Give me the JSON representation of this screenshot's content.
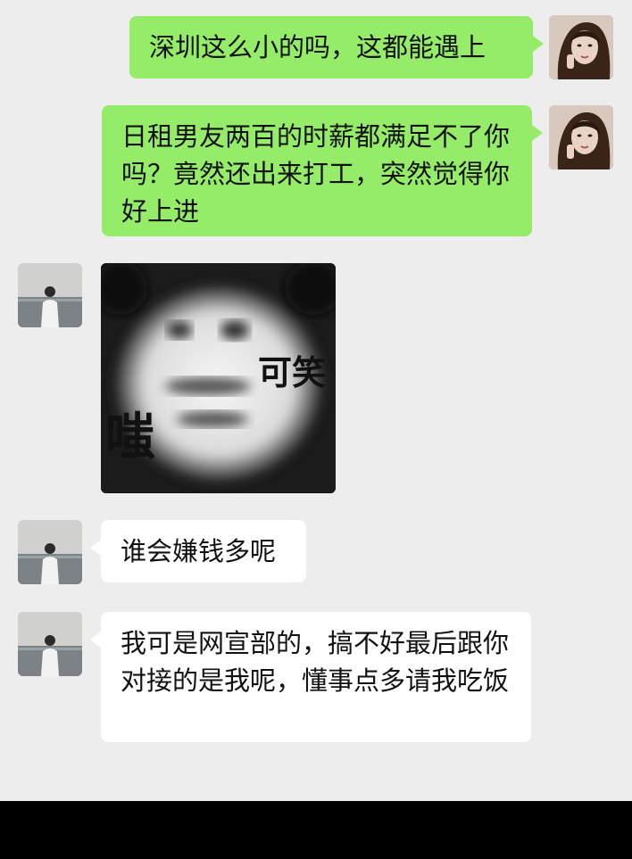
{
  "messages": [
    {
      "side": "right",
      "text": "深圳这么小的吗，这都能遇上"
    },
    {
      "side": "right",
      "text": "日租男友两百的时薪都满足不了你吗？竟然还出来打工，突然觉得你好上进"
    },
    {
      "side": "left",
      "sticker": {
        "text_top": "可笑",
        "text_left": "嗤"
      }
    },
    {
      "side": "left",
      "text": "谁会嫌钱多呢"
    },
    {
      "side": "left",
      "text": "我可是网宣部的，搞不好最后跟你对接的是我呢，懂事点多请我吃饭"
    }
  ],
  "colors": {
    "background": "#ededed",
    "outgoing_bubble": "#95ec69",
    "incoming_bubble": "#ffffff",
    "bottom_bar": "#000000"
  }
}
